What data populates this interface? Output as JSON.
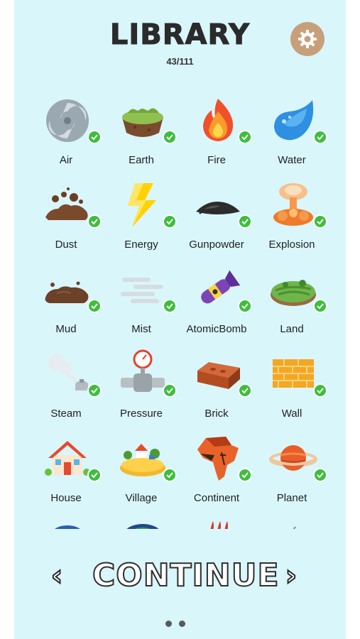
{
  "header": {
    "title": "LIBRARY",
    "counter": "43/111"
  },
  "settings": {
    "icon": "gear-icon",
    "color": "#c79f7a"
  },
  "colors": {
    "background": "#d9f6fb",
    "check": "#3cbf3c"
  },
  "elements": [
    {
      "label": "Air",
      "icon": "air-icon",
      "unlocked": true
    },
    {
      "label": "Earth",
      "icon": "earth-icon",
      "unlocked": true
    },
    {
      "label": "Fire",
      "icon": "fire-icon",
      "unlocked": true
    },
    {
      "label": "Water",
      "icon": "water-icon",
      "unlocked": true
    },
    {
      "label": "Dust",
      "icon": "dust-icon",
      "unlocked": true
    },
    {
      "label": "Energy",
      "icon": "energy-icon",
      "unlocked": true
    },
    {
      "label": "Gunpowder",
      "icon": "gunpowder-icon",
      "unlocked": true
    },
    {
      "label": "Explosion",
      "icon": "explosion-icon",
      "unlocked": true
    },
    {
      "label": "Mud",
      "icon": "mud-icon",
      "unlocked": true
    },
    {
      "label": "Mist",
      "icon": "mist-icon",
      "unlocked": true
    },
    {
      "label": "AtomicBomb",
      "icon": "atomic-bomb-icon",
      "unlocked": true
    },
    {
      "label": "Land",
      "icon": "land-icon",
      "unlocked": true
    },
    {
      "label": "Steam",
      "icon": "steam-icon",
      "unlocked": true
    },
    {
      "label": "Pressure",
      "icon": "pressure-icon",
      "unlocked": true
    },
    {
      "label": "Brick",
      "icon": "brick-icon",
      "unlocked": true
    },
    {
      "label": "Wall",
      "icon": "wall-icon",
      "unlocked": true
    },
    {
      "label": "House",
      "icon": "house-icon",
      "unlocked": true
    },
    {
      "label": "Village",
      "icon": "village-icon",
      "unlocked": true
    },
    {
      "label": "Continent",
      "icon": "continent-icon",
      "unlocked": true
    },
    {
      "label": "Planet",
      "icon": "planet-icon",
      "unlocked": true
    }
  ],
  "continue_button": {
    "label": "CONTINUE",
    "prev_icon": "chevron-left-icon",
    "next_icon": "chevron-right-icon"
  },
  "pagination": {
    "pages": 2,
    "current": 1
  }
}
